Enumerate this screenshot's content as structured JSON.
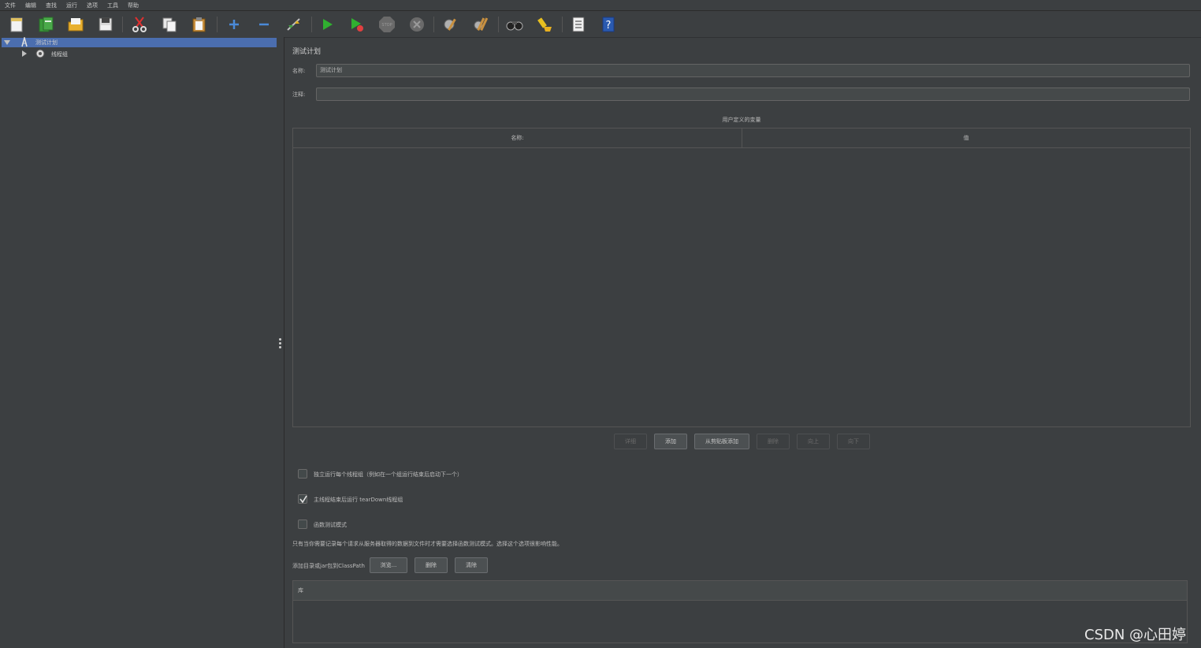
{
  "menu": [
    "文件",
    "编辑",
    "查找",
    "运行",
    "选项",
    "工具",
    "帮助"
  ],
  "toolbar": {
    "icons": [
      "new-icon",
      "templates-icon",
      "open-icon",
      "save-icon",
      "cut-icon",
      "copy-icon",
      "paste-icon",
      "expand-icon",
      "collapse-icon",
      "toggle-icon",
      "start-icon",
      "start-no-pause-icon",
      "stop-icon",
      "shutdown-icon",
      "clear-icon",
      "clear-all-icon",
      "search-icon",
      "reset-search-icon",
      "function-helper-icon",
      "help-icon"
    ]
  },
  "tree": {
    "root_label": "测试计划",
    "child_label": "线程组"
  },
  "panel": {
    "title": "测试计划",
    "name_label": "名称:",
    "name_value": "测试计划",
    "comment_label": "注释:",
    "comment_value": "",
    "variables_title": "用户定义的变量",
    "columns": [
      "名称:",
      "值"
    ]
  },
  "buttons": {
    "detail": "详细",
    "add": "添加",
    "add_clipboard": "从剪贴板添加",
    "delete": "删除",
    "up": "向上",
    "down": "向下"
  },
  "options": {
    "run_consecutively": {
      "label": "独立运行每个线程组（例如在一个组运行结束后启动下一个）",
      "checked": false
    },
    "teardown": {
      "label": "主线程结束后运行 tearDown线程组",
      "checked": true
    },
    "functional_mode": {
      "label": "函数测试模式",
      "checked": false
    },
    "note": "只有当你需要记录每个请求从服务器取得的数据到文件时才需要选择函数测试模式。选择这个选项很影响性能。"
  },
  "classpath": {
    "label": "添加目录或jar包到ClassPath",
    "browse": "浏览...",
    "delete": "删除",
    "clear": "清除",
    "column": "库"
  },
  "watermark": "CSDN @心田婷"
}
